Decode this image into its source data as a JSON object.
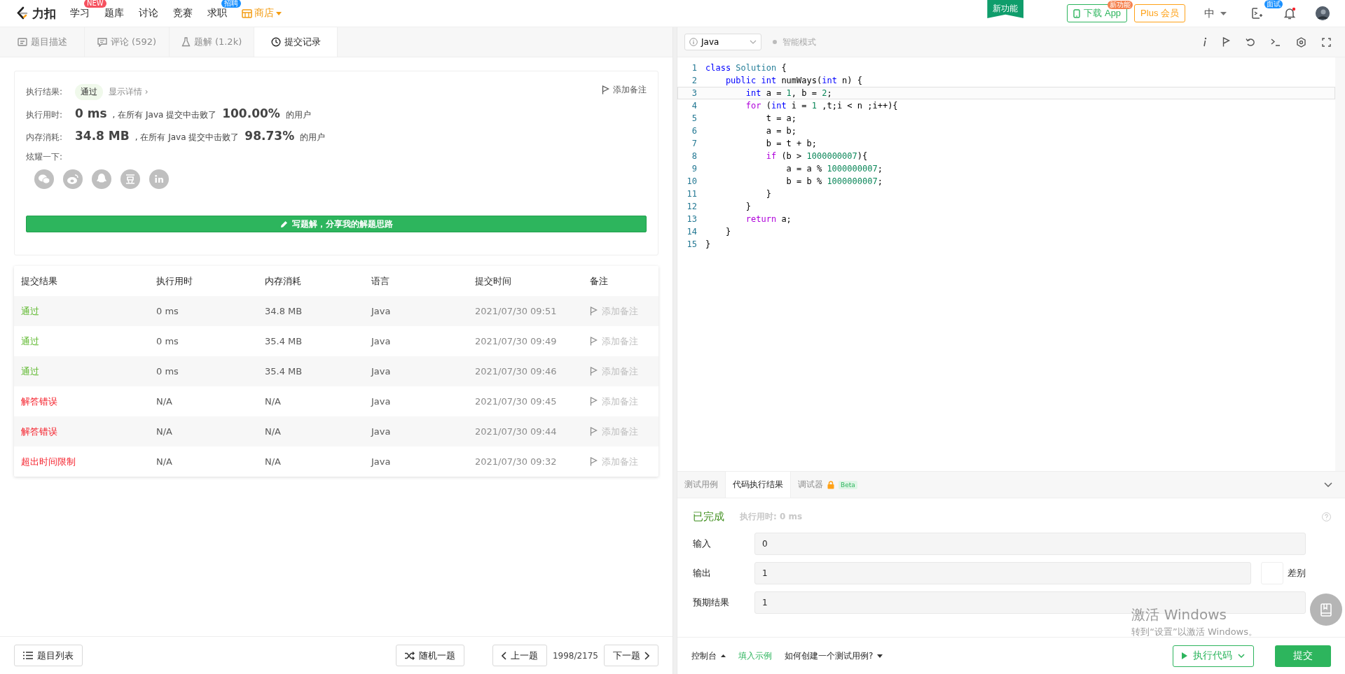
{
  "nav": {
    "logo": "力扣",
    "items": [
      {
        "label": "学习",
        "badge": "NEW",
        "kind": "plain"
      },
      {
        "label": "题库",
        "kind": "plain"
      },
      {
        "label": "讨论",
        "kind": "plain"
      },
      {
        "label": "竞赛",
        "kind": "plain"
      },
      {
        "label": "求职",
        "badge": "招聘",
        "kind": "plain"
      },
      {
        "label": "商店",
        "kind": "shop"
      }
    ],
    "new_feature": "新功能",
    "download": {
      "label": "下载 App",
      "badge": "新功能"
    },
    "plus": "Plus 会员",
    "lang": "中",
    "interview_badge": "面试"
  },
  "left_tabs": [
    {
      "label": "题目描述",
      "selected": false,
      "kind": "desc"
    },
    {
      "label": "评论 (592)",
      "selected": false,
      "kind": "comment"
    },
    {
      "label": "题解 (1.2k)",
      "selected": false,
      "kind": "solution"
    },
    {
      "label": "提交记录",
      "selected": true,
      "kind": "history"
    }
  ],
  "result": {
    "status_label": "执行结果:",
    "status": "通过",
    "details": "显示详情 ›",
    "add_note": "添加备注",
    "runtime_label": "执行用时:",
    "runtime": "0 ms",
    "runtime_text": ", 在所有 Java 提交中击败了",
    "runtime_pct": "100.00%",
    "runtime_suffix": "的用户",
    "memory_label": "内存消耗:",
    "memory": "34.8 MB",
    "memory_text": ", 在所有 Java 提交中击败了",
    "memory_pct": "98.73%",
    "memory_suffix": "的用户",
    "share_label": "炫耀一下:",
    "write_button": "写题解，分享我的解题思路"
  },
  "table": {
    "columns": [
      "提交结果",
      "执行用时",
      "内存消耗",
      "语言",
      "提交时间",
      "备注"
    ],
    "rows": [
      {
        "status": "通过",
        "kind": "accepted",
        "runtime": "0 ms",
        "memory": "34.8 MB",
        "language": "Java",
        "submitted": "2021/07/30 09:51",
        "note": "添加备注"
      },
      {
        "status": "通过",
        "kind": "accepted",
        "runtime": "0 ms",
        "memory": "35.4 MB",
        "language": "Java",
        "submitted": "2021/07/30 09:49",
        "note": "添加备注"
      },
      {
        "status": "通过",
        "kind": "accepted",
        "runtime": "0 ms",
        "memory": "35.4 MB",
        "language": "Java",
        "submitted": "2021/07/30 09:46",
        "note": "添加备注"
      },
      {
        "status": "解答错误",
        "kind": "failed",
        "runtime": "N/A",
        "memory": "N/A",
        "language": "Java",
        "submitted": "2021/07/30 09:45",
        "note": "添加备注"
      },
      {
        "status": "解答错误",
        "kind": "failed",
        "runtime": "N/A",
        "memory": "N/A",
        "language": "Java",
        "submitted": "2021/07/30 09:44",
        "note": "添加备注"
      },
      {
        "status": "超出时间限制",
        "kind": "failed",
        "runtime": "N/A",
        "memory": "N/A",
        "language": "Java",
        "submitted": "2021/07/30 09:32",
        "note": "添加备注"
      }
    ]
  },
  "pager": {
    "list": "题目列表",
    "random": "随机一题",
    "prev": "上一题",
    "count": "1998/2175",
    "next": "下一题"
  },
  "editor": {
    "language": "Java",
    "mode": "智能模式",
    "lines": [
      {
        "n": "1",
        "current": false,
        "tokens": [
          {
            "kind": "kw",
            "text": "class"
          },
          {
            "kind": "type",
            "text": " Solution"
          },
          {
            "kind": "p",
            "text": " {"
          }
        ]
      },
      {
        "n": "2",
        "current": false,
        "tokens": [
          {
            "kind": "kw",
            "text": "    public"
          },
          {
            "kind": "kw",
            "text": " int"
          },
          {
            "kind": "p",
            "text": " numWays("
          },
          {
            "kind": "kw",
            "text": "int"
          },
          {
            "kind": "p",
            "text": " n) {"
          }
        ]
      },
      {
        "n": "3",
        "current": true,
        "tokens": [
          {
            "kind": "kw",
            "text": "        int"
          },
          {
            "kind": "p",
            "text": " a = "
          },
          {
            "kind": "num",
            "text": "1"
          },
          {
            "kind": "p",
            "text": ", b = "
          },
          {
            "kind": "num",
            "text": "2"
          },
          {
            "kind": "p",
            "text": ";"
          }
        ]
      },
      {
        "n": "4",
        "current": false,
        "tokens": [
          {
            "kind": "ctl",
            "text": "        for"
          },
          {
            "kind": "p",
            "text": " ("
          },
          {
            "kind": "kw",
            "text": "int"
          },
          {
            "kind": "p",
            "text": " i = "
          },
          {
            "kind": "num",
            "text": "1"
          },
          {
            "kind": "p",
            "text": " ,t;i < n ;i++){"
          }
        ]
      },
      {
        "n": "5",
        "current": false,
        "tokens": [
          {
            "kind": "p",
            "text": "            t = a;"
          }
        ]
      },
      {
        "n": "6",
        "current": false,
        "tokens": [
          {
            "kind": "p",
            "text": "            a = b;"
          }
        ]
      },
      {
        "n": "7",
        "current": false,
        "tokens": [
          {
            "kind": "p",
            "text": "            b = t + b;"
          }
        ]
      },
      {
        "n": "8",
        "current": false,
        "tokens": [
          {
            "kind": "ctl",
            "text": "            if"
          },
          {
            "kind": "p",
            "text": " (b > "
          },
          {
            "kind": "num",
            "text": "1000000007"
          },
          {
            "kind": "p",
            "text": "){"
          }
        ]
      },
      {
        "n": "9",
        "current": false,
        "tokens": [
          {
            "kind": "p",
            "text": "                a = a % "
          },
          {
            "kind": "num",
            "text": "1000000007"
          },
          {
            "kind": "p",
            "text": ";"
          }
        ]
      },
      {
        "n": "10",
        "current": false,
        "tokens": [
          {
            "kind": "p",
            "text": "                b = b % "
          },
          {
            "kind": "num",
            "text": "1000000007"
          },
          {
            "kind": "p",
            "text": ";"
          }
        ]
      },
      {
        "n": "11",
        "current": false,
        "tokens": [
          {
            "kind": "p",
            "text": "            }"
          }
        ]
      },
      {
        "n": "12",
        "current": false,
        "tokens": [
          {
            "kind": "p",
            "text": "        }"
          }
        ]
      },
      {
        "n": "13",
        "current": false,
        "tokens": [
          {
            "kind": "ctl",
            "text": "        return"
          },
          {
            "kind": "p",
            "text": " a;"
          }
        ]
      },
      {
        "n": "14",
        "current": false,
        "tokens": [
          {
            "kind": "p",
            "text": "    }"
          }
        ]
      },
      {
        "n": "15",
        "current": false,
        "tokens": [
          {
            "kind": "p",
            "text": "}"
          }
        ]
      }
    ]
  },
  "console": {
    "tabs": [
      {
        "label": "测试用例",
        "selected": false,
        "kind": "plain"
      },
      {
        "label": "代码执行结果",
        "selected": true,
        "kind": "plain"
      },
      {
        "label": "调试器",
        "selected": false,
        "kind": "locked",
        "badge": "Beta"
      }
    ],
    "status": "已完成",
    "runtime": "执行用时: 0 ms",
    "fields": [
      {
        "label": "输入",
        "value": "0",
        "kind": "plain"
      },
      {
        "label": "输出",
        "value": "1",
        "kind": "diff",
        "toggle": "差别"
      },
      {
        "label": "预期结果",
        "value": "1",
        "kind": "plain"
      }
    ]
  },
  "footer": {
    "console": "控制台",
    "example": "填入示例",
    "howto": "如何创建一个测试用例?",
    "run": "执行代码",
    "submit": "提交"
  },
  "os_overlay": {
    "title": "激活 Windows",
    "subtitle": "转到“设置”以激活 Windows。"
  }
}
